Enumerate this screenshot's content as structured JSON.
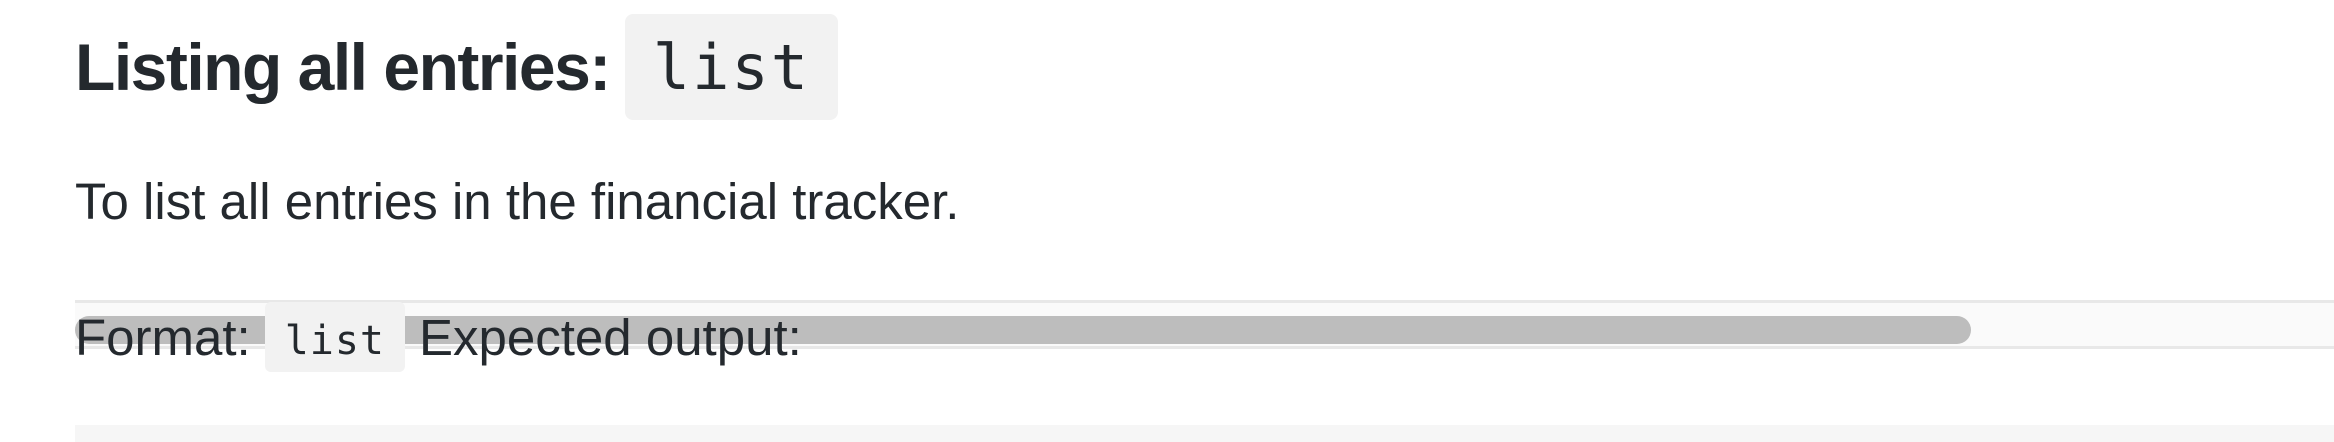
{
  "section": {
    "heading_text": "Listing all entries:",
    "heading_command": "list",
    "description": "To list all entries in the financial tracker.",
    "format_label": "Format:",
    "format_command": "list",
    "expected_output_label": "Expected output:"
  }
}
